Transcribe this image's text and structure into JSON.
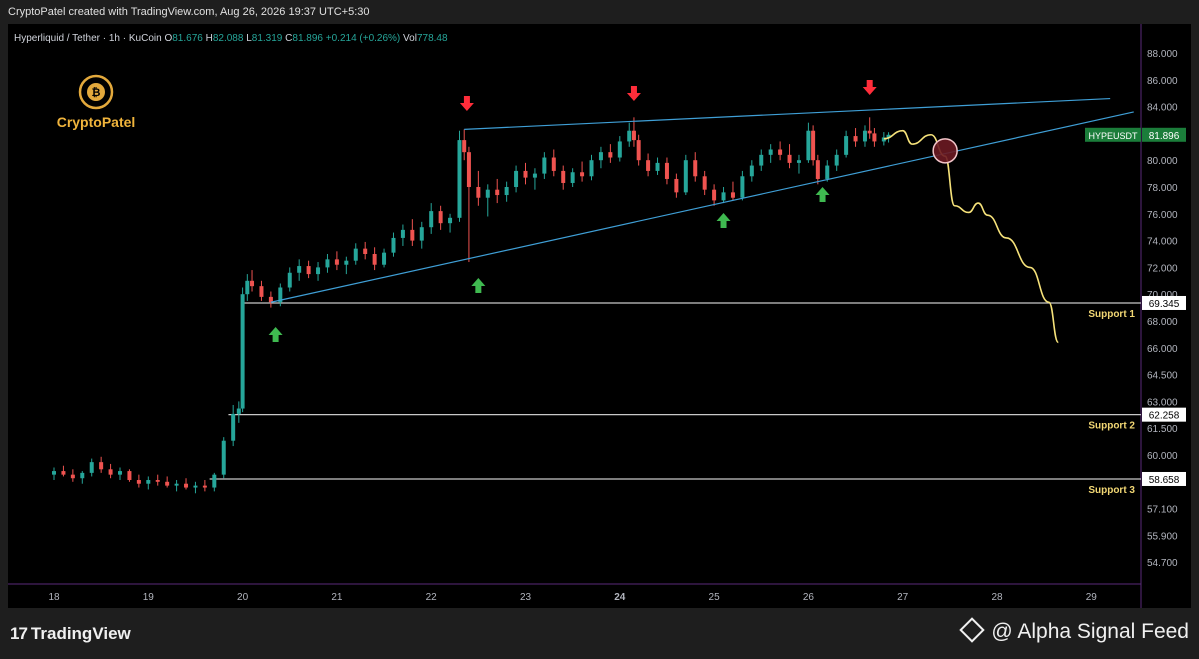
{
  "header": {
    "credit": "CryptoPatel created with TradingView.com, Aug 26, 2026 19:37 UTC+5:30"
  },
  "legend": {
    "symbol": "Hyperliquid / Tether · 1h · KuCoin",
    "o_label": "O",
    "o_value": "81.676",
    "h_label": "H",
    "h_value": "82.088",
    "l_label": "L",
    "l_value": "81.319",
    "c_label": "C",
    "c_value": "81.896",
    "change": "+0.214 (+0.26%)",
    "vol_label": "Vol",
    "vol_value": "778.48"
  },
  "brand": {
    "name": "CryptoPatel"
  },
  "footer": {
    "tv_logo": "TradingView",
    "watermark": "@ Alpha Signal Feed"
  },
  "chart_data": {
    "type": "candlestick",
    "symbol": "HYPEUSDT",
    "last_price_label": "HYPEUSDT",
    "last_price": "81.896",
    "x_ticks": [
      "18",
      "19",
      "20",
      "21",
      "22",
      "23",
      "24",
      "25",
      "26",
      "27",
      "28",
      "29"
    ],
    "x_range": [
      17.5,
      29.5
    ],
    "y_ticks": [
      "88.000",
      "86.000",
      "84.000",
      "82.000",
      "80.000",
      "78.000",
      "76.000",
      "74.000",
      "72.000",
      "70.000",
      "68.000",
      "66.000",
      "64.500",
      "63.000",
      "61.500",
      "60.000",
      "58.500",
      "57.100",
      "55.900",
      "54.700"
    ],
    "ohlc": [
      {
        "x": 18.0,
        "o": 58.9,
        "h": 59.3,
        "l": 58.6,
        "c": 59.1
      },
      {
        "x": 18.1,
        "o": 59.1,
        "h": 59.4,
        "l": 58.8,
        "c": 58.9
      },
      {
        "x": 18.2,
        "o": 58.9,
        "h": 59.2,
        "l": 58.5,
        "c": 58.7
      },
      {
        "x": 18.3,
        "o": 58.7,
        "h": 59.1,
        "l": 58.4,
        "c": 59.0
      },
      {
        "x": 18.4,
        "o": 59.0,
        "h": 59.8,
        "l": 58.8,
        "c": 59.6
      },
      {
        "x": 18.5,
        "o": 59.6,
        "h": 59.9,
        "l": 59.0,
        "c": 59.2
      },
      {
        "x": 18.6,
        "o": 59.2,
        "h": 59.5,
        "l": 58.7,
        "c": 58.9
      },
      {
        "x": 18.7,
        "o": 58.9,
        "h": 59.3,
        "l": 58.6,
        "c": 59.1
      },
      {
        "x": 18.8,
        "o": 59.1,
        "h": 59.2,
        "l": 58.5,
        "c": 58.6
      },
      {
        "x": 18.9,
        "o": 58.6,
        "h": 58.9,
        "l": 58.2,
        "c": 58.4
      },
      {
        "x": 19.0,
        "o": 58.4,
        "h": 58.8,
        "l": 58.1,
        "c": 58.6
      },
      {
        "x": 19.1,
        "o": 58.6,
        "h": 58.9,
        "l": 58.3,
        "c": 58.5
      },
      {
        "x": 19.2,
        "o": 58.5,
        "h": 58.8,
        "l": 58.2,
        "c": 58.3
      },
      {
        "x": 19.3,
        "o": 58.3,
        "h": 58.6,
        "l": 58.0,
        "c": 58.4
      },
      {
        "x": 19.4,
        "o": 58.4,
        "h": 58.7,
        "l": 58.1,
        "c": 58.2
      },
      {
        "x": 19.5,
        "o": 58.2,
        "h": 58.5,
        "l": 57.9,
        "c": 58.3
      },
      {
        "x": 19.6,
        "o": 58.3,
        "h": 58.6,
        "l": 58.0,
        "c": 58.2
      },
      {
        "x": 19.7,
        "o": 58.2,
        "h": 59.0,
        "l": 58.0,
        "c": 58.9
      },
      {
        "x": 19.8,
        "o": 58.9,
        "h": 61.0,
        "l": 58.7,
        "c": 60.8
      },
      {
        "x": 19.9,
        "o": 60.8,
        "h": 62.8,
        "l": 60.5,
        "c": 62.3
      },
      {
        "x": 19.96,
        "o": 62.3,
        "h": 63.0,
        "l": 61.8,
        "c": 62.6
      },
      {
        "x": 20.0,
        "o": 62.6,
        "h": 70.5,
        "l": 62.4,
        "c": 70.0
      },
      {
        "x": 20.05,
        "o": 70.0,
        "h": 71.5,
        "l": 69.5,
        "c": 71.0
      },
      {
        "x": 20.1,
        "o": 71.0,
        "h": 71.8,
        "l": 70.2,
        "c": 70.6
      },
      {
        "x": 20.2,
        "o": 70.6,
        "h": 71.0,
        "l": 69.5,
        "c": 69.8
      },
      {
        "x": 20.3,
        "o": 69.8,
        "h": 70.2,
        "l": 69.0,
        "c": 69.4
      },
      {
        "x": 20.4,
        "o": 69.4,
        "h": 70.8,
        "l": 69.1,
        "c": 70.5
      },
      {
        "x": 20.5,
        "o": 70.5,
        "h": 72.0,
        "l": 70.2,
        "c": 71.6
      },
      {
        "x": 20.6,
        "o": 71.6,
        "h": 72.6,
        "l": 71.0,
        "c": 72.1
      },
      {
        "x": 20.7,
        "o": 72.1,
        "h": 72.5,
        "l": 71.2,
        "c": 71.5
      },
      {
        "x": 20.8,
        "o": 71.5,
        "h": 72.4,
        "l": 71.0,
        "c": 72.0
      },
      {
        "x": 20.9,
        "o": 72.0,
        "h": 73.0,
        "l": 71.6,
        "c": 72.6
      },
      {
        "x": 21.0,
        "o": 72.6,
        "h": 73.2,
        "l": 71.8,
        "c": 72.2
      },
      {
        "x": 21.1,
        "o": 72.2,
        "h": 72.8,
        "l": 71.5,
        "c": 72.5
      },
      {
        "x": 21.2,
        "o": 72.5,
        "h": 73.8,
        "l": 72.2,
        "c": 73.4
      },
      {
        "x": 21.3,
        "o": 73.4,
        "h": 73.9,
        "l": 72.6,
        "c": 73.0
      },
      {
        "x": 21.4,
        "o": 73.0,
        "h": 73.5,
        "l": 71.8,
        "c": 72.2
      },
      {
        "x": 21.5,
        "o": 72.2,
        "h": 73.4,
        "l": 72.0,
        "c": 73.1
      },
      {
        "x": 21.6,
        "o": 73.1,
        "h": 74.6,
        "l": 72.8,
        "c": 74.2
      },
      {
        "x": 21.7,
        "o": 74.2,
        "h": 75.2,
        "l": 73.6,
        "c": 74.8
      },
      {
        "x": 21.8,
        "o": 74.8,
        "h": 75.6,
        "l": 73.6,
        "c": 74.0
      },
      {
        "x": 21.9,
        "o": 74.0,
        "h": 75.4,
        "l": 73.4,
        "c": 75.0
      },
      {
        "x": 22.0,
        "o": 75.0,
        "h": 76.8,
        "l": 74.5,
        "c": 76.2
      },
      {
        "x": 22.1,
        "o": 76.2,
        "h": 76.6,
        "l": 74.8,
        "c": 75.3
      },
      {
        "x": 22.2,
        "o": 75.3,
        "h": 76.0,
        "l": 74.6,
        "c": 75.7
      },
      {
        "x": 22.3,
        "o": 75.7,
        "h": 82.2,
        "l": 75.4,
        "c": 81.5
      },
      {
        "x": 22.35,
        "o": 81.5,
        "h": 82.3,
        "l": 80.0,
        "c": 80.6
      },
      {
        "x": 22.4,
        "o": 80.6,
        "h": 81.0,
        "l": 72.4,
        "c": 78.0
      },
      {
        "x": 22.5,
        "o": 78.0,
        "h": 79.2,
        "l": 76.6,
        "c": 77.2
      },
      {
        "x": 22.6,
        "o": 77.2,
        "h": 78.2,
        "l": 75.8,
        "c": 77.8
      },
      {
        "x": 22.7,
        "o": 77.8,
        "h": 78.6,
        "l": 76.8,
        "c": 77.4
      },
      {
        "x": 22.8,
        "o": 77.4,
        "h": 78.4,
        "l": 76.9,
        "c": 78.0
      },
      {
        "x": 22.9,
        "o": 78.0,
        "h": 79.6,
        "l": 77.6,
        "c": 79.2
      },
      {
        "x": 23.0,
        "o": 79.2,
        "h": 79.8,
        "l": 78.2,
        "c": 78.7
      },
      {
        "x": 23.1,
        "o": 78.7,
        "h": 79.4,
        "l": 77.8,
        "c": 79.0
      },
      {
        "x": 23.2,
        "o": 79.0,
        "h": 80.6,
        "l": 78.6,
        "c": 80.2
      },
      {
        "x": 23.3,
        "o": 80.2,
        "h": 80.8,
        "l": 78.8,
        "c": 79.2
      },
      {
        "x": 23.4,
        "o": 79.2,
        "h": 79.6,
        "l": 77.8,
        "c": 78.3
      },
      {
        "x": 23.5,
        "o": 78.3,
        "h": 79.4,
        "l": 78.0,
        "c": 79.1
      },
      {
        "x": 23.6,
        "o": 79.1,
        "h": 79.9,
        "l": 78.4,
        "c": 78.8
      },
      {
        "x": 23.7,
        "o": 78.8,
        "h": 80.4,
        "l": 78.5,
        "c": 80.0
      },
      {
        "x": 23.8,
        "o": 80.0,
        "h": 81.0,
        "l": 79.4,
        "c": 80.6
      },
      {
        "x": 23.9,
        "o": 80.6,
        "h": 81.2,
        "l": 79.8,
        "c": 80.2
      },
      {
        "x": 24.0,
        "o": 80.2,
        "h": 81.8,
        "l": 79.9,
        "c": 81.4
      },
      {
        "x": 24.1,
        "o": 81.4,
        "h": 82.8,
        "l": 81.0,
        "c": 82.2
      },
      {
        "x": 24.15,
        "o": 82.2,
        "h": 83.2,
        "l": 81.0,
        "c": 81.5
      },
      {
        "x": 24.2,
        "o": 81.5,
        "h": 81.9,
        "l": 79.6,
        "c": 80.0
      },
      {
        "x": 24.3,
        "o": 80.0,
        "h": 80.5,
        "l": 78.8,
        "c": 79.2
      },
      {
        "x": 24.4,
        "o": 79.2,
        "h": 80.2,
        "l": 78.9,
        "c": 79.8
      },
      {
        "x": 24.5,
        "o": 79.8,
        "h": 80.2,
        "l": 78.2,
        "c": 78.6
      },
      {
        "x": 24.6,
        "o": 78.6,
        "h": 79.0,
        "l": 77.2,
        "c": 77.6
      },
      {
        "x": 24.7,
        "o": 77.6,
        "h": 80.4,
        "l": 77.4,
        "c": 80.0
      },
      {
        "x": 24.8,
        "o": 80.0,
        "h": 80.6,
        "l": 78.4,
        "c": 78.8
      },
      {
        "x": 24.9,
        "o": 78.8,
        "h": 79.2,
        "l": 77.4,
        "c": 77.8
      },
      {
        "x": 25.0,
        "o": 77.8,
        "h": 78.2,
        "l": 76.6,
        "c": 77.0
      },
      {
        "x": 25.1,
        "o": 77.0,
        "h": 78.0,
        "l": 76.8,
        "c": 77.6
      },
      {
        "x": 25.2,
        "o": 77.6,
        "h": 78.4,
        "l": 77.0,
        "c": 77.2
      },
      {
        "x": 25.3,
        "o": 77.2,
        "h": 79.2,
        "l": 77.0,
        "c": 78.8
      },
      {
        "x": 25.4,
        "o": 78.8,
        "h": 80.0,
        "l": 78.4,
        "c": 79.6
      },
      {
        "x": 25.5,
        "o": 79.6,
        "h": 80.8,
        "l": 79.2,
        "c": 80.4
      },
      {
        "x": 25.6,
        "o": 80.4,
        "h": 81.2,
        "l": 79.8,
        "c": 80.8
      },
      {
        "x": 25.7,
        "o": 80.8,
        "h": 81.4,
        "l": 80.0,
        "c": 80.4
      },
      {
        "x": 25.8,
        "o": 80.4,
        "h": 81.2,
        "l": 79.4,
        "c": 79.8
      },
      {
        "x": 25.9,
        "o": 79.8,
        "h": 80.4,
        "l": 79.0,
        "c": 80.0
      },
      {
        "x": 26.0,
        "o": 80.0,
        "h": 82.8,
        "l": 79.8,
        "c": 82.2
      },
      {
        "x": 26.05,
        "o": 82.2,
        "h": 82.6,
        "l": 79.6,
        "c": 80.0
      },
      {
        "x": 26.1,
        "o": 80.0,
        "h": 80.4,
        "l": 78.2,
        "c": 78.6
      },
      {
        "x": 26.2,
        "o": 78.6,
        "h": 80.0,
        "l": 78.4,
        "c": 79.6
      },
      {
        "x": 26.3,
        "o": 79.6,
        "h": 80.8,
        "l": 79.2,
        "c": 80.4
      },
      {
        "x": 26.4,
        "o": 80.4,
        "h": 82.2,
        "l": 80.2,
        "c": 81.8
      },
      {
        "x": 26.5,
        "o": 81.8,
        "h": 82.4,
        "l": 81.0,
        "c": 81.4
      },
      {
        "x": 26.6,
        "o": 81.4,
        "h": 82.6,
        "l": 81.0,
        "c": 82.2
      },
      {
        "x": 26.65,
        "o": 82.2,
        "h": 83.2,
        "l": 81.6,
        "c": 82.0
      },
      {
        "x": 26.7,
        "o": 82.0,
        "h": 82.4,
        "l": 81.0,
        "c": 81.4
      },
      {
        "x": 26.8,
        "o": 81.4,
        "h": 82.1,
        "l": 81.1,
        "c": 81.7
      },
      {
        "x": 26.85,
        "o": 81.676,
        "h": 82.088,
        "l": 81.319,
        "c": 81.896
      }
    ],
    "support_levels": [
      {
        "label": "Support 1",
        "value": "69.345"
      },
      {
        "label": "Support 2",
        "value": "62.258"
      },
      {
        "label": "Support 3",
        "value": "58.658"
      }
    ],
    "rising_wedge": {
      "upper": [
        [
          22.35,
          82.3
        ],
        [
          29.2,
          84.6
        ]
      ],
      "lower": [
        [
          20.3,
          69.4
        ],
        [
          29.45,
          83.6
        ]
      ]
    },
    "projection": [
      [
        26.8,
        81.6
      ],
      [
        27.0,
        82.2
      ],
      [
        27.1,
        81.2
      ],
      [
        27.3,
        81.9
      ],
      [
        27.45,
        80.3
      ],
      [
        27.55,
        76.6
      ],
      [
        27.7,
        76.1
      ],
      [
        27.8,
        76.8
      ],
      [
        27.9,
        75.9
      ],
      [
        28.1,
        74.2
      ],
      [
        28.35,
        72.0
      ],
      [
        28.55,
        69.4
      ],
      [
        28.65,
        66.4
      ]
    ],
    "breakdown_marker": [
      27.45,
      80.7
    ],
    "red_arrows_x": [
      22.4,
      24.15,
      26.65
    ],
    "green_arrows_x": [
      20.35,
      22.5,
      25.1,
      26.15
    ],
    "colors": {
      "up": "#26a69a",
      "down": "#ef5350",
      "bg": "#000000",
      "wedge": "#3f9fd6",
      "support": "#c8c8c8",
      "projection": "#f6e27a",
      "support_label": "#f2d774",
      "arrow_up": "#3fb950",
      "arrow_down": "#ff2d3a",
      "price_badge": "#1b7d3a"
    }
  }
}
